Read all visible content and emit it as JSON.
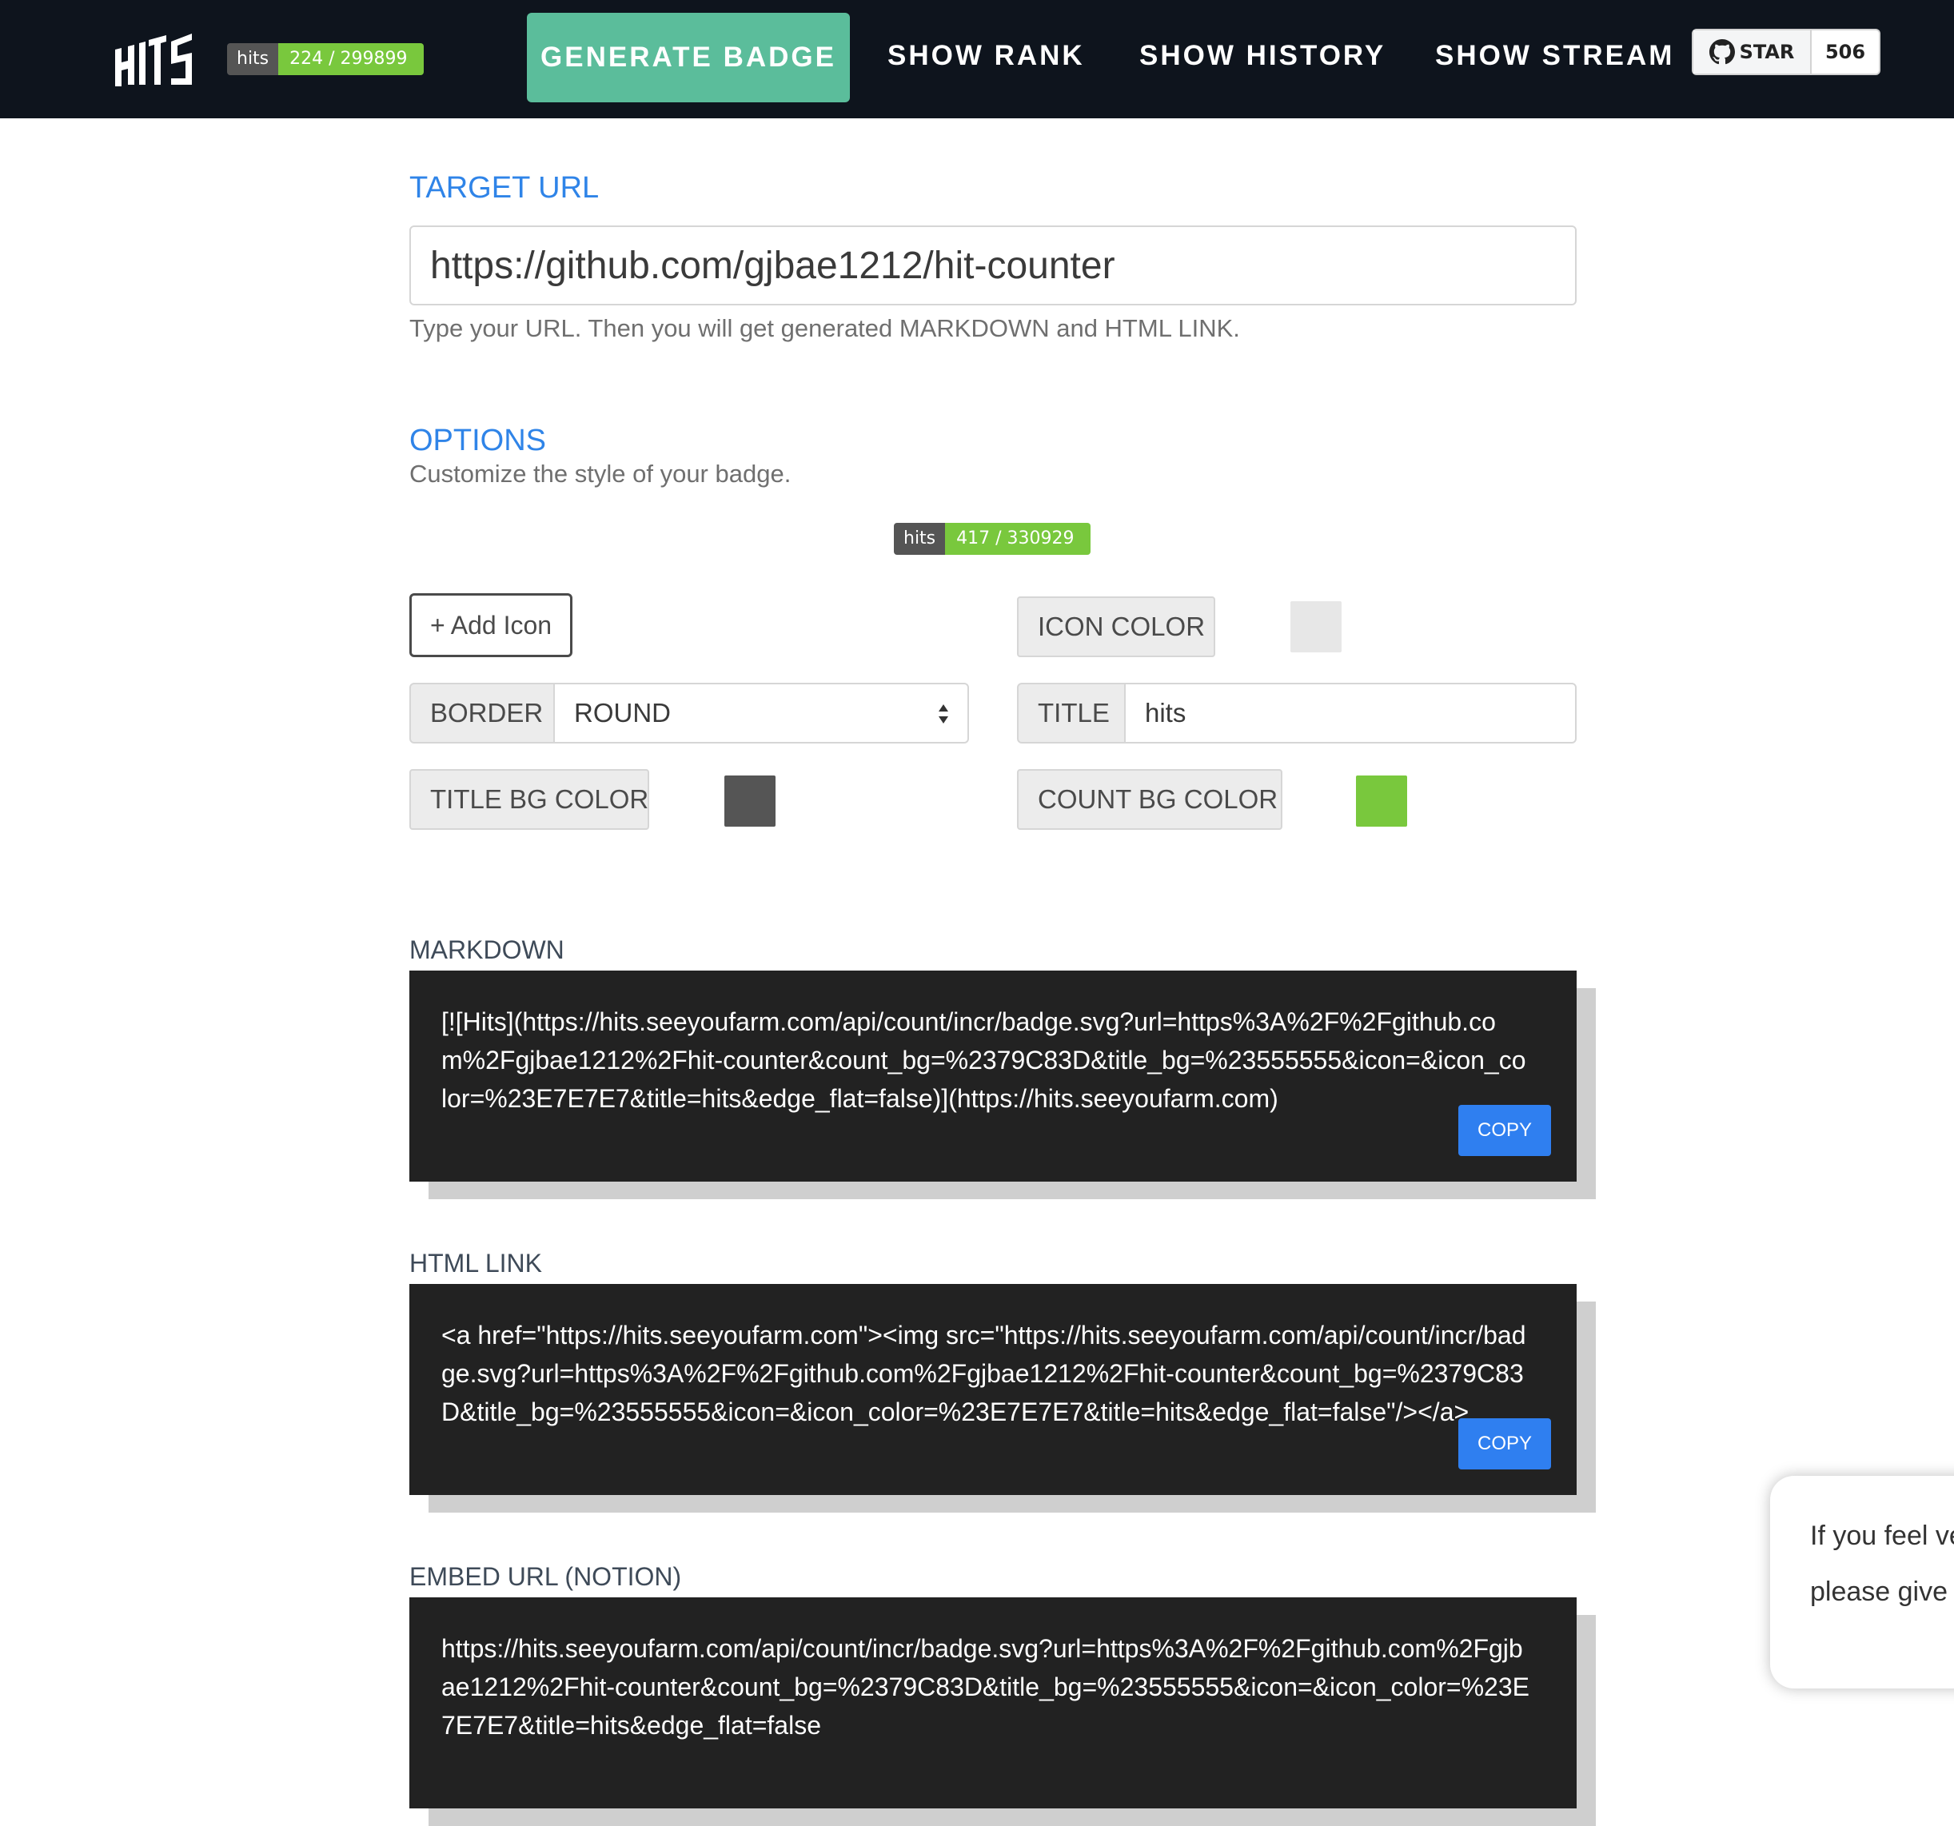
{
  "nav": {
    "logo_text": "HITS",
    "badge": {
      "title": "hits",
      "count": "224 / 299899"
    },
    "generate_label": "GENERATE BADGE",
    "rank_label": "SHOW RANK",
    "history_label": "SHOW HISTORY",
    "stream_label": "SHOW STREAM",
    "star": {
      "label": "STAR",
      "count": "506"
    }
  },
  "target": {
    "heading": "TARGET URL",
    "url_value": "https://github.com/gjbae1212/hit-counter",
    "help": "Type your URL. Then you will get generated MARKDOWN and HTML LINK."
  },
  "options": {
    "heading": "OPTIONS",
    "subheading": "Customize the style of your badge.",
    "preview_badge": {
      "title": "hits",
      "count": "417 / 330929"
    },
    "add_icon_label": "+ Add Icon",
    "icon_color_label": "ICON COLOR",
    "border_label": "BORDER",
    "border_value": "ROUND",
    "title_label": "TITLE",
    "title_value": "hits",
    "title_bg_label": "TITLE BG COLOR",
    "count_bg_label": "COUNT BG COLOR",
    "colors": {
      "icon": "#E7E7E7",
      "title_bg": "#555555",
      "count_bg": "#79C83D"
    }
  },
  "outputs": {
    "copy_label": "COPY",
    "markdown": {
      "label": "MARKDOWN",
      "code": "[![Hits](https://hits.seeyoufarm.com/api/count/incr/badge.svg?url=https%3A%2F%2Fgithub.com%2Fgjbae1212%2Fhit-counter&count_bg=%2379C83D&title_bg=%23555555&icon=&icon_color=%23E7E7E7&title=hits&edge_flat=false)](https://hits.seeyoufarm.com)"
    },
    "html": {
      "label": "HTML LINK",
      "code": "<a href=\"https://hits.seeyoufarm.com\"><img src=\"https://hits.seeyoufarm.com/api/count/incr/badge.svg?url=https%3A%2F%2Fgithub.com%2Fgjbae1212%2Fhit-counter&count_bg=%2379C83D&title_bg=%23555555&icon=&icon_color=%23E7E7E7&title=hits&edge_flat=false\"/></a>"
    },
    "embed": {
      "label": "EMBED URL (NOTION)",
      "code": "https://hits.seeyoufarm.com/api/count/incr/badge.svg?url=https%3A%2F%2Fgithub.com%2Fgjbae1212%2Fhit-counter&count_bg=%2379C83D&title_bg=%23555555&icon=&icon_color=%23E7E7E7&title=hits&edge_flat=false"
    }
  },
  "float_card": {
    "line1": "If you feel ve",
    "line2": "please give a"
  }
}
